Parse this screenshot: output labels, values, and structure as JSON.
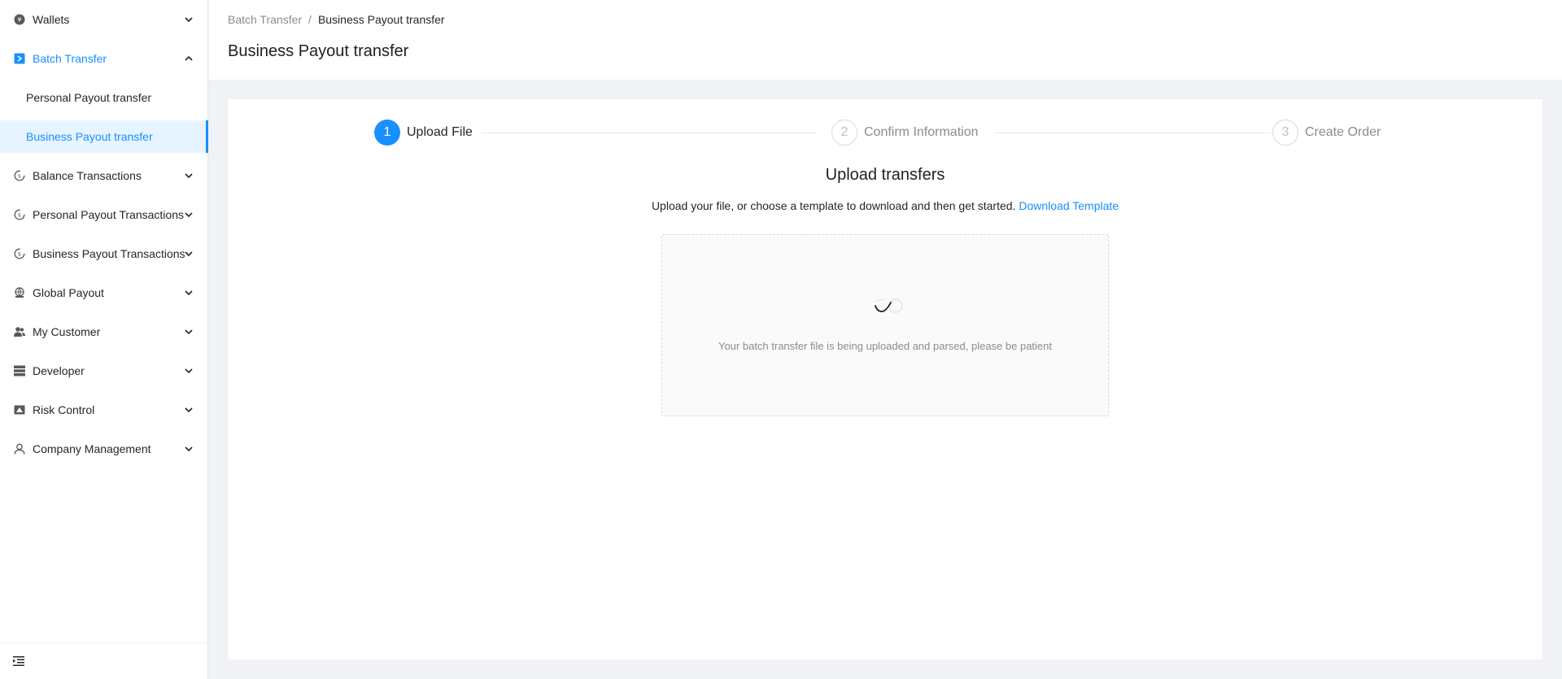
{
  "sidebar": {
    "items": [
      {
        "label": "Wallets",
        "icon": "wallet-icon",
        "expanded": false
      },
      {
        "label": "Batch Transfer",
        "icon": "batch-transfer-icon",
        "expanded": true,
        "children": [
          {
            "label": "Personal Payout transfer",
            "selected": false
          },
          {
            "label": "Business Payout transfer",
            "selected": true
          }
        ]
      },
      {
        "label": "Balance Transactions",
        "icon": "transactions-icon",
        "expanded": false
      },
      {
        "label": "Personal Payout Transactions",
        "icon": "transactions-icon",
        "expanded": false
      },
      {
        "label": "Business Payout Transactions",
        "icon": "transactions-icon",
        "expanded": false
      },
      {
        "label": "Global Payout",
        "icon": "global-payout-icon",
        "expanded": false
      },
      {
        "label": "My Customer",
        "icon": "customers-icon",
        "expanded": false
      },
      {
        "label": "Developer",
        "icon": "developer-icon",
        "expanded": false
      },
      {
        "label": "Risk Control",
        "icon": "risk-control-icon",
        "expanded": false
      },
      {
        "label": "Company Management",
        "icon": "company-icon",
        "expanded": false
      }
    ],
    "footer_icon": "menu-collapse-icon"
  },
  "header": {
    "breadcrumb": [
      "Batch Transfer",
      "Business Payout transfer"
    ],
    "separator": "/",
    "title": "Business Payout transfer"
  },
  "steps": [
    {
      "number": "1",
      "label": "Upload File",
      "status": "active"
    },
    {
      "number": "2",
      "label": "Confirm Information",
      "status": "wait"
    },
    {
      "number": "3",
      "label": "Create Order",
      "status": "wait"
    }
  ],
  "upload": {
    "title": "Upload transfers",
    "description": "Upload your file, or choose a template to download and then get started.",
    "template_link": "Download Template",
    "status_text": "Your batch transfer file is being uploaded and parsed, please be patient",
    "status_icon": "loading-spinner-icon"
  },
  "colors": {
    "primary": "#1890ff",
    "selected_bg": "#e6f4ff",
    "page_bg": "#f0f2f5"
  }
}
